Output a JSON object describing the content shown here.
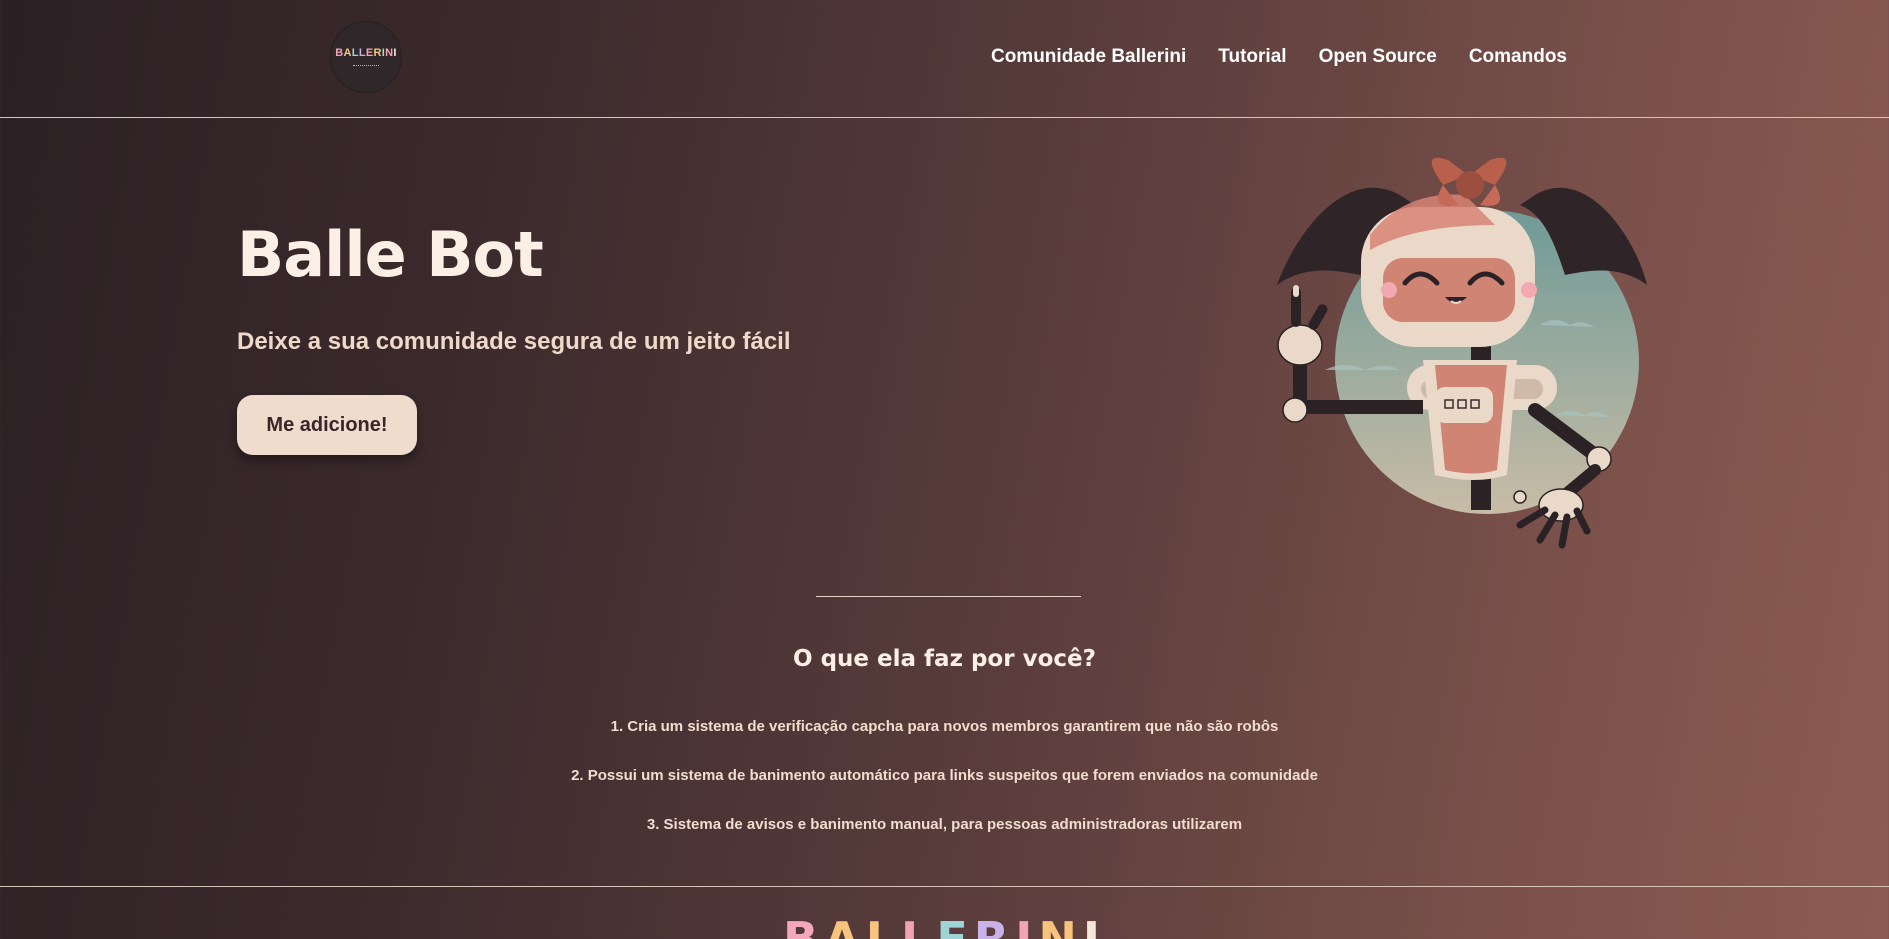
{
  "nav": {
    "logo_text": "BALLERINI",
    "links": [
      "Comunidade Ballerini",
      "Tutorial",
      "Open Source",
      "Comandos"
    ]
  },
  "hero": {
    "title": "Balle Bot",
    "subtitle": "Deixe a sua comunidade segura de um jeito fácil",
    "cta_label": "Me adicione!"
  },
  "features": {
    "title": "O que ela faz por você?",
    "items": [
      "1. Cria um sistema de verificação capcha para novos membros garantirem que não são robôs",
      "2. Possui um sistema de banimento automático para links suspeitos que forem enviados na comunidade",
      "3. Sistema de avisos e banimento manual, para pessoas administradoras utilizarem"
    ]
  },
  "footer": {
    "logo_text": "BALLERINI"
  },
  "colors": {
    "bg_dark": "#2c2024",
    "bg_light": "#8c5c52",
    "button_bg": "#f0dccd",
    "text_light": "#fbefe6"
  }
}
